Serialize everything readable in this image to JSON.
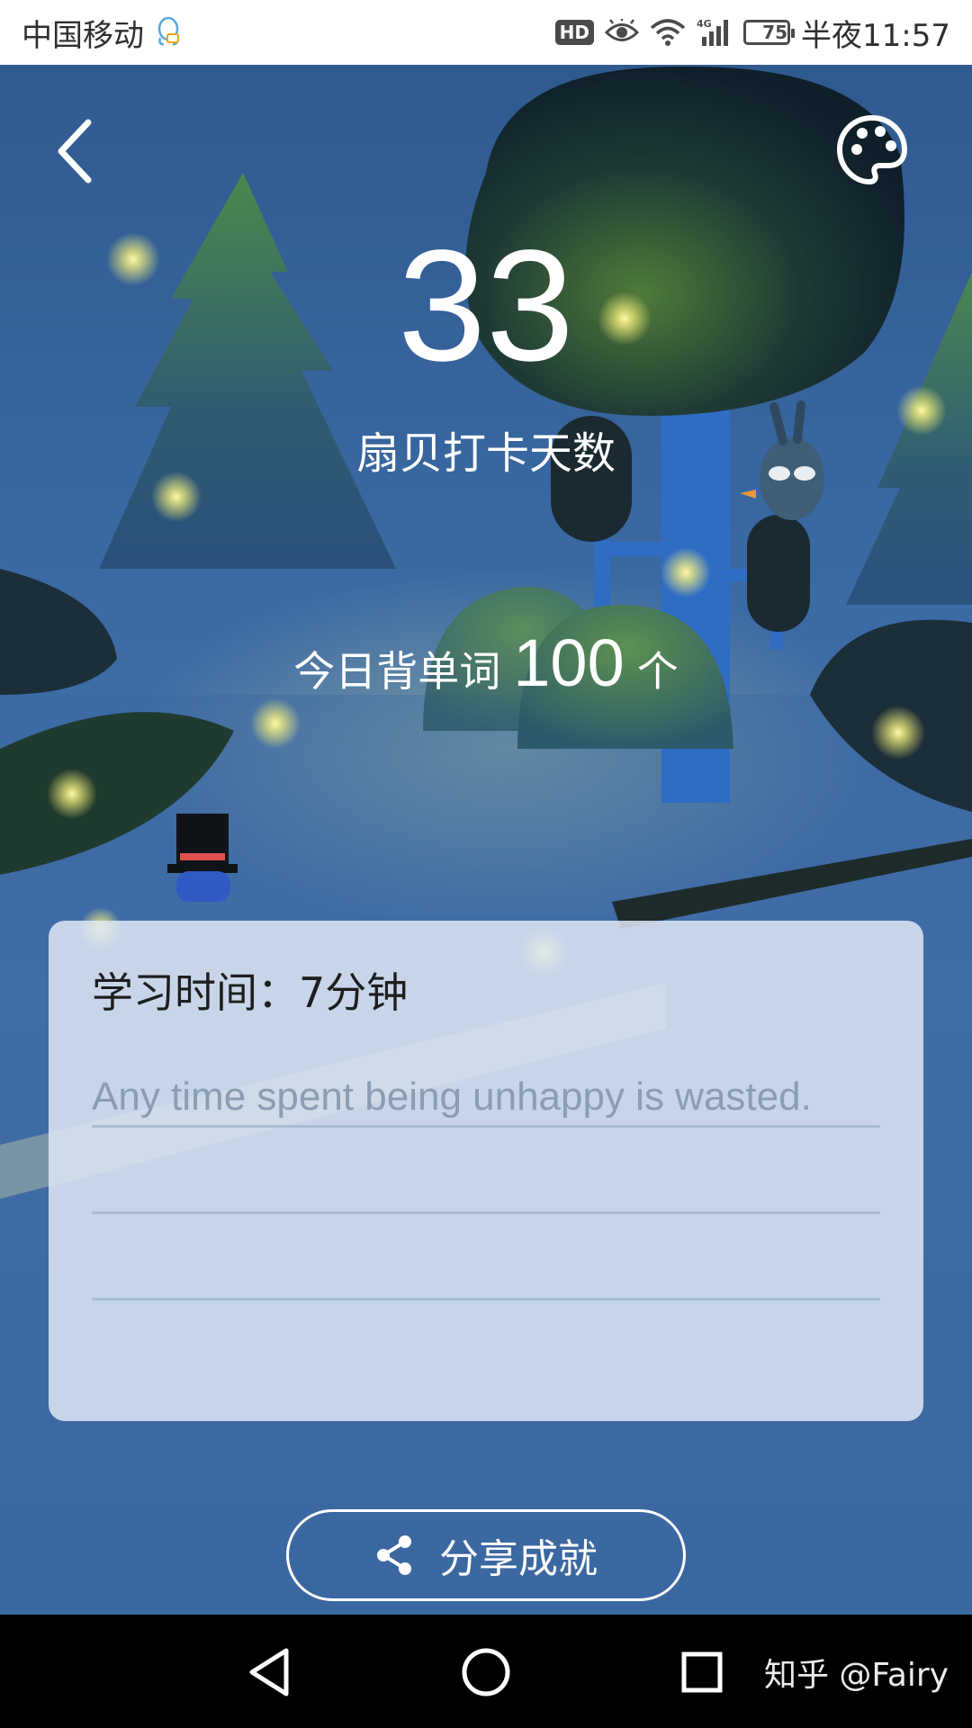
{
  "status_bar": {
    "carrier": "中国移动",
    "hd_badge": "HD",
    "network_type": "4G",
    "battery_level": "75",
    "time": "半夜11:57"
  },
  "header": {
    "back_icon": "chevron-left-icon",
    "theme_icon": "palette-icon"
  },
  "stats": {
    "checkin_days": "33",
    "checkin_label": "扇贝打卡天数",
    "words_prefix": "今日背单词",
    "words_count": "100",
    "words_suffix": "个"
  },
  "card": {
    "study_time": "学习时间：7分钟",
    "quote": "Any time spent being unhappy is wasted."
  },
  "share_button": {
    "label": "分享成就",
    "icon": "share-icon"
  },
  "nav_bar": {
    "back_icon": "triangle-back-icon",
    "home_icon": "circle-home-icon",
    "recents_icon": "square-recents-icon",
    "watermark": "知乎 @Fairy"
  },
  "colors": {
    "background": "#3b6aa4",
    "card": "#dee7f4",
    "quote_text": "#8a9db3"
  }
}
